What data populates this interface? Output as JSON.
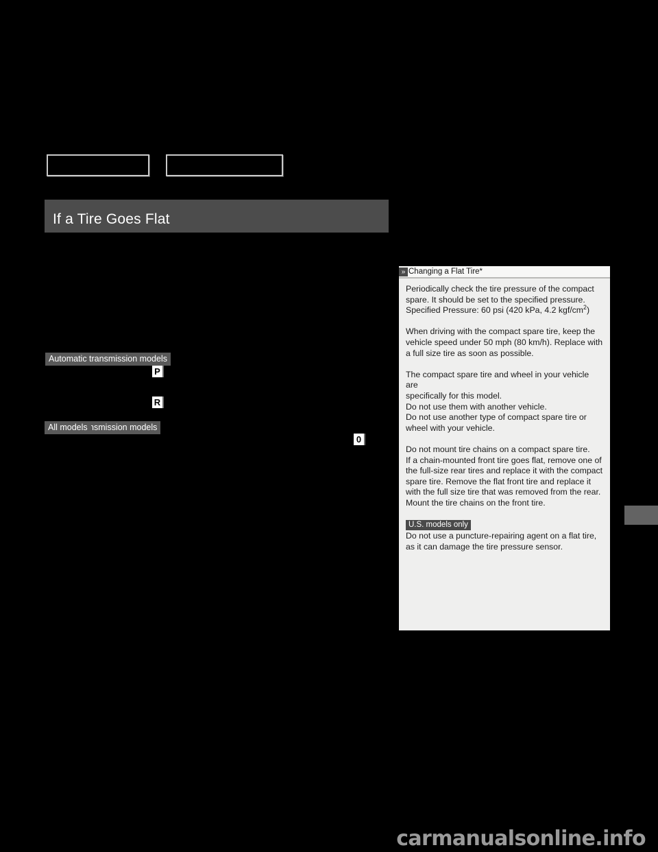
{
  "page": {
    "background_color": "#000000",
    "watermark": "carmanualsonline.info"
  },
  "header": {
    "boxes": [
      {
        "name": "header-box-left",
        "label": ""
      },
      {
        "name": "header-box-right",
        "label": ""
      }
    ]
  },
  "section": {
    "title": "If a Tire Goes Flat",
    "title_bar_color": "#4c4c4c"
  },
  "left_column": {
    "badges": [
      {
        "label": "Automatic transmission models"
      },
      {
        "label": "Manual transmission models"
      },
      {
        "label": "All models"
      }
    ],
    "glyphs": [
      {
        "name": "gear-position-park-glyph",
        "label": "P"
      },
      {
        "name": "gear-position-reverse-glyph",
        "label": "R"
      },
      {
        "name": "indicator-glyph",
        "label": "0"
      }
    ]
  },
  "info_panel": {
    "chevron_icon": "»",
    "title": "Changing a Flat Tire*",
    "background_color": "#efefee",
    "paragraphs": [
      {
        "lines": [
          "Periodically check the tire pressure of the compact",
          "spare. It should be set to the specified pressure.",
          "Specified Pressure: 60 psi (420 kPa, 4.2 kgf/cm"
        ],
        "superscript_tail": "2",
        "tail": ")"
      },
      {
        "lines": [
          "When driving with the compact spare tire, keep the",
          "vehicle speed under 50 mph (80 km/h). Replace with",
          "a full size tire as soon as possible."
        ]
      },
      {
        "lines": [
          "The compact spare tire and wheel in your vehicle are",
          "specifically for this model.",
          "Do not use them with another vehicle.",
          "Do not use another type of compact spare tire or",
          "wheel with your vehicle."
        ]
      },
      {
        "lines": [
          "Do not mount tire chains on a compact spare tire.",
          "If a chain-mounted front tire goes flat, remove one of",
          "the full-size rear tires and replace it with the compact",
          "spare tire. Remove the flat front tire and replace it",
          "with the full size tire that was removed from the rear.",
          "Mount the tire chains on the front tire."
        ]
      }
    ],
    "us_note": {
      "badge": "U.S. models only",
      "lines": [
        "Do not use a puncture-repairing agent on a flat tire,",
        "as it can damage the tire pressure sensor."
      ]
    }
  },
  "edge_tab": {
    "color": "#636363"
  },
  "text": {
    "para1_l1": "Periodically check the tire pressure of the compact",
    "para1_l2": "spare. It should be set to the specified pressure.",
    "para1_l3": "Specified Pressure: 60 psi (420 kPa, 4.2 kgf/cm",
    "para1_sup": "2",
    "para1_tail": ")",
    "para2_l1": "When driving with the compact spare tire, keep the",
    "para2_l2": "vehicle speed under 50 mph (80 km/h). Replace with",
    "para2_l3": "a full size tire as soon as possible.",
    "para3_l1": "The compact spare tire and wheel in your vehicle are",
    "para3_l2": "specifically for this model.",
    "para3_l3": "Do not use them with another vehicle.",
    "para3_l4": "Do not use another type of compact spare tire or",
    "para3_l5": "wheel with your vehicle.",
    "para4_l1": "Do not mount tire chains on a compact spare tire.",
    "para4_l2": "If a chain-mounted front tire goes flat, remove one of",
    "para4_l3": "the full-size rear tires and replace it with the compact",
    "para4_l4": "spare tire. Remove the flat front tire and replace it",
    "para4_l5": "with the full size tire that was removed from the rear.",
    "para4_l6": "Mount the tire chains on the front tire.",
    "us_badge": "U.S. models only",
    "us_l1": "Do not use a puncture-repairing agent on a flat tire,",
    "us_l2": "as it can damage the tire pressure sensor."
  }
}
